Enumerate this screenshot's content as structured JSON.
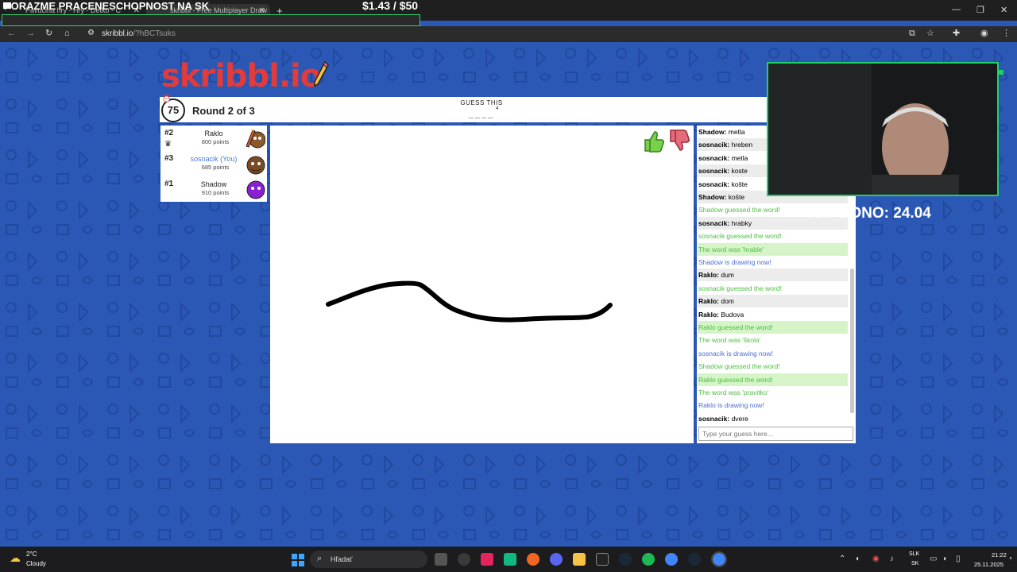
{
  "overlay": {
    "title": "PORAZME PRACENESCHOPNOST NA SK",
    "money": "$1.43  / $50",
    "goal_progress": 0.02,
    "top_dono": "TOP DONO: 24.04"
  },
  "browser": {
    "tabs": [
      {
        "label": "Pavučina hry - Hry - Detko - C"
      },
      {
        "label": "skribbl - Free Multiplayer Draw"
      }
    ],
    "new_tab": "+",
    "url_host": "skribbl.io",
    "url_path": "/?hBCTsuks",
    "window_controls": {
      "minimize": "—",
      "maximize": "❐",
      "close": "✕"
    }
  },
  "game": {
    "logo": "skribbl.io",
    "timer": "75",
    "round": "Round 2 of 3",
    "guess_label": "GUESS THIS",
    "word_blanks": "____",
    "word_length": "4",
    "players": [
      {
        "rank": "#2",
        "name": "Raklo",
        "points": "800 points",
        "color": "#222222"
      },
      {
        "rank": "#3",
        "name": "sosnacik (You)",
        "points": "685 points",
        "color": "#4a7bd6"
      },
      {
        "rank": "#1",
        "name": "Shadow",
        "points": "910 points",
        "color": "#222222"
      }
    ],
    "chat": [
      {
        "who": "Shadow:",
        "text": " metla",
        "kind": "normal"
      },
      {
        "who": "sosnacik:",
        "text": " hreben",
        "kind": "normal"
      },
      {
        "who": "sosnacik:",
        "text": " metla",
        "kind": "normal"
      },
      {
        "who": "sosnacik:",
        "text": " koste",
        "kind": "normal"
      },
      {
        "who": "sosnacik:",
        "text": " košte",
        "kind": "normal"
      },
      {
        "who": "Shadow:",
        "text": " košte",
        "kind": "normal"
      },
      {
        "who": "",
        "text": "Shadow guessed the word!",
        "kind": "green"
      },
      {
        "who": "sosnacik:",
        "text": " hrabky",
        "kind": "normal"
      },
      {
        "who": "",
        "text": "sosnacik guessed the word!",
        "kind": "green"
      },
      {
        "who": "",
        "text": "The word was 'hrable'",
        "kind": "green"
      },
      {
        "who": "",
        "text": "Shadow is drawing now!",
        "kind": "blue"
      },
      {
        "who": "Raklo:",
        "text": " dum",
        "kind": "normal"
      },
      {
        "who": "",
        "text": "sosnacik guessed the word!",
        "kind": "green"
      },
      {
        "who": "Raklo:",
        "text": " dom",
        "kind": "normal"
      },
      {
        "who": "Raklo:",
        "text": " Budova",
        "kind": "normal"
      },
      {
        "who": "",
        "text": "Raklo guessed the word!",
        "kind": "green"
      },
      {
        "who": "",
        "text": "The word was 'škola'",
        "kind": "green"
      },
      {
        "who": "",
        "text": "sosnacik is drawing now!",
        "kind": "blue"
      },
      {
        "who": "",
        "text": "Shadow guessed the word!",
        "kind": "green"
      },
      {
        "who": "",
        "text": "Raklo guessed the word!",
        "kind": "green"
      },
      {
        "who": "",
        "text": "The word was 'pravitko'",
        "kind": "green"
      },
      {
        "who": "",
        "text": "Raklo is drawing now!",
        "kind": "blue"
      },
      {
        "who": "sosnacik:",
        "text": " dvere",
        "kind": "normal"
      }
    ],
    "chat_placeholder": "Type your guess here..."
  },
  "taskbar": {
    "weather_temp": "2°C",
    "weather_desc": "Cloudy",
    "search_label": "Hľadať",
    "lang_top": "SLK",
    "lang_bottom": "SK",
    "time": "21:22",
    "date": "25.11.2025"
  },
  "colors": {
    "page_bg": "#2b58b5",
    "chat_green": "#4cbf3e",
    "chat_blue": "#4a6ed8",
    "goal_border": "#1fd164"
  }
}
